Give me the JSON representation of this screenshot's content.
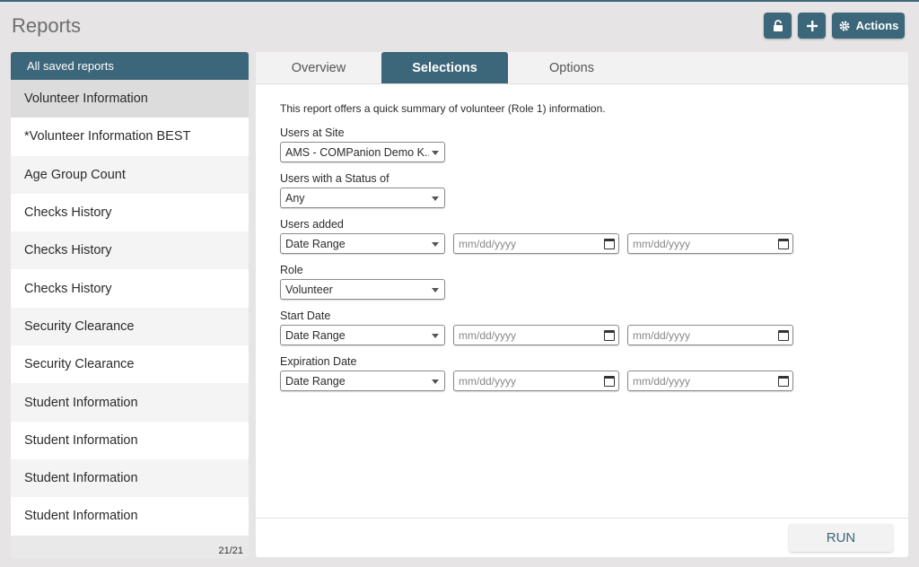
{
  "header": {
    "title": "Reports",
    "lock_icon": "lock-icon",
    "add_icon": "plus-icon",
    "actions_label": "Actions",
    "actions_icon": "gear-icon"
  },
  "sidebar": {
    "header": "All saved reports",
    "items": [
      {
        "label": "Volunteer Information",
        "active": true
      },
      {
        "label": "*Volunteer Information BEST"
      },
      {
        "label": "Age Group Count"
      },
      {
        "label": "Checks History"
      },
      {
        "label": "Checks History"
      },
      {
        "label": "Checks History"
      },
      {
        "label": "Security Clearance"
      },
      {
        "label": "Security Clearance"
      },
      {
        "label": "Student Information"
      },
      {
        "label": "Student Information"
      },
      {
        "label": "Student Information"
      },
      {
        "label": "Student Information"
      }
    ],
    "count": "21/21"
  },
  "tabs": {
    "overview": "Overview",
    "selections": "Selections",
    "options": "Options"
  },
  "form": {
    "description": "This report offers a quick summary of volunteer (Role 1) information.",
    "users_at_site": {
      "label": "Users at Site",
      "value": "AMS - COMPanion Demo K..."
    },
    "status": {
      "label": "Users with a Status of",
      "value": "Any"
    },
    "users_added": {
      "label": "Users added",
      "value": "Date Range",
      "from_placeholder": "mm/dd/yyyy",
      "to_placeholder": "mm/dd/yyyy"
    },
    "role": {
      "label": "Role",
      "value": "Volunteer"
    },
    "start_date": {
      "label": "Start Date",
      "value": "Date Range",
      "from_placeholder": "mm/dd/yyyy",
      "to_placeholder": "mm/dd/yyyy"
    },
    "expiration_date": {
      "label": "Expiration Date",
      "value": "Date Range",
      "from_placeholder": "mm/dd/yyyy",
      "to_placeholder": "mm/dd/yyyy"
    }
  },
  "run_label": "RUN",
  "colors": {
    "accent": "#3c6679",
    "background": "#e6e4e4"
  }
}
